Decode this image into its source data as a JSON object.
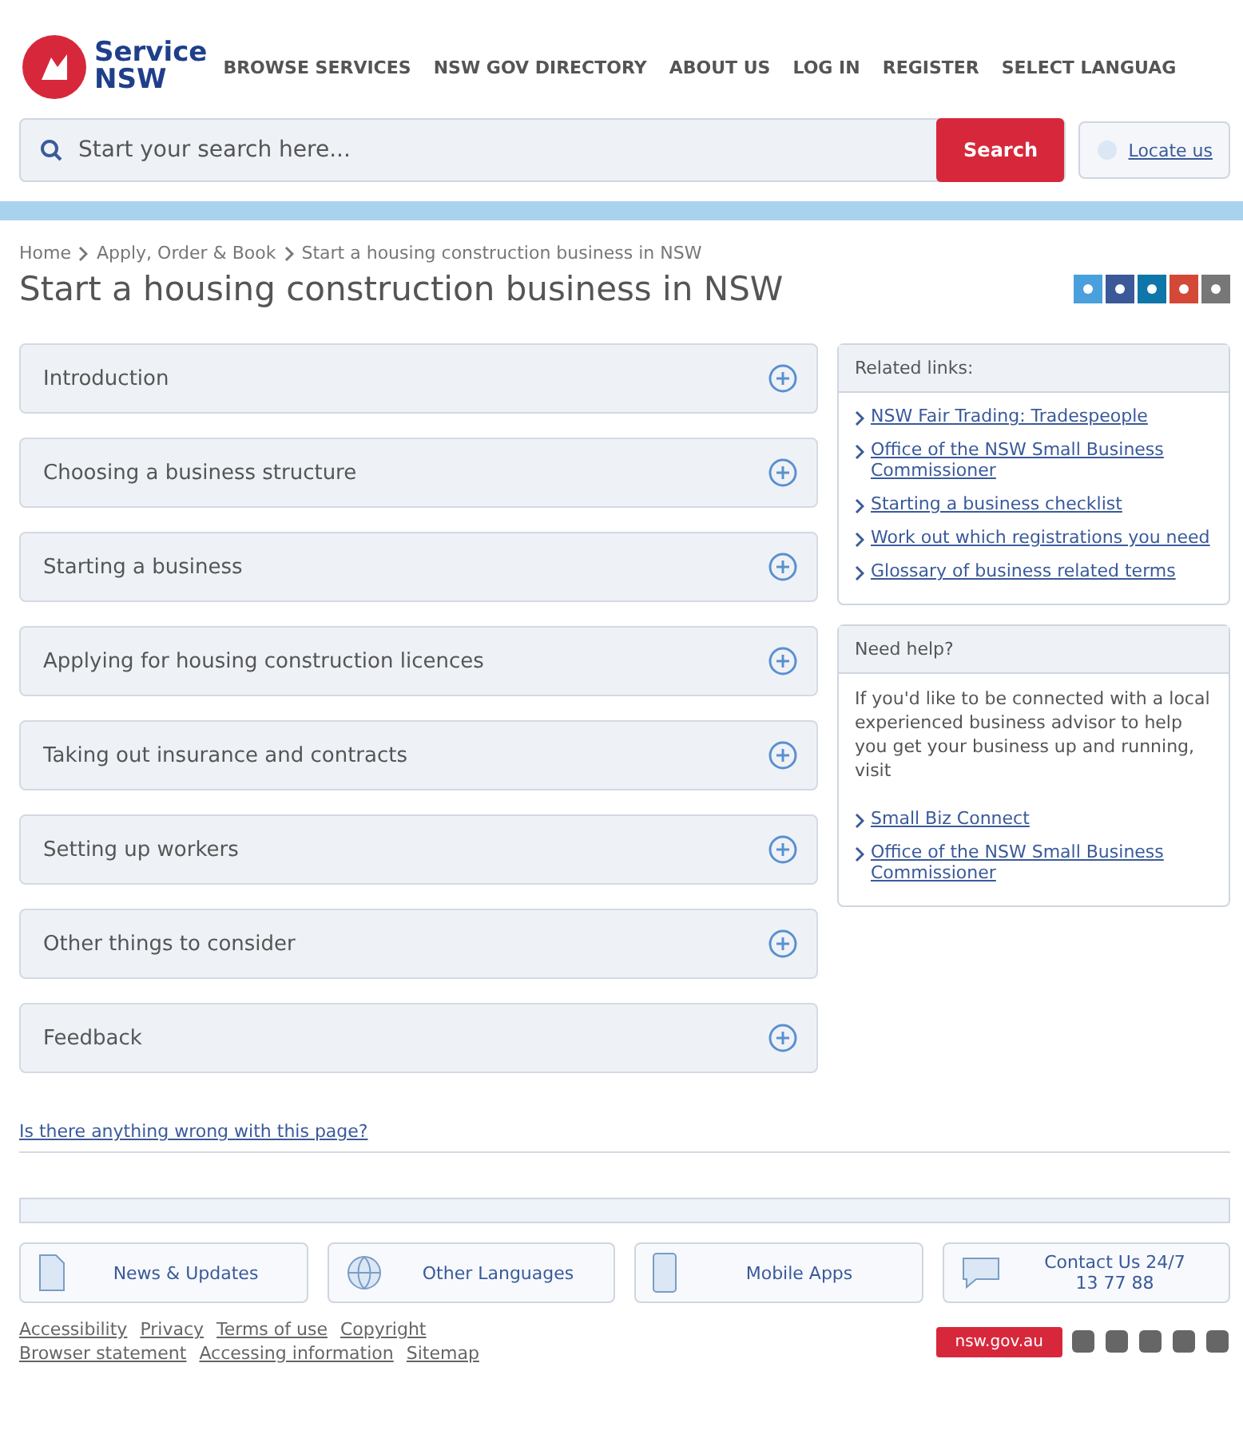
{
  "header": {
    "logo": {
      "line1": "Service",
      "line2": "NSW"
    },
    "nav": [
      "BROWSE SERVICES",
      "NSW GOV DIRECTORY",
      "ABOUT US",
      "LOG IN",
      "REGISTER",
      "SELECT LANGUAG"
    ]
  },
  "search": {
    "placeholder": "Start your search here...",
    "button": "Search",
    "locate": "Locate us"
  },
  "breadcrumb": [
    "Home",
    "Apply, Order & Book",
    "Start a housing construction business in NSW"
  ],
  "title": "Start a housing construction business in NSW",
  "accordion": [
    {
      "label": "Introduction"
    },
    {
      "label": "Choosing a business structure"
    },
    {
      "label": "Starting a business"
    },
    {
      "label": "Applying for housing construction licences"
    },
    {
      "label": "Taking out insurance and contracts"
    },
    {
      "label": "Setting up workers"
    },
    {
      "label": "Other things to consider"
    },
    {
      "label": "Feedback"
    }
  ],
  "related_links": {
    "title": "Related links:",
    "links": [
      "NSW Fair Trading: Tradespeople",
      "Office of the NSW Small Business Commissioner",
      "Starting a business checklist",
      "Work out which registrations you need",
      "Glossary of business related terms"
    ]
  },
  "need_help": {
    "title": "Need help?",
    "text": "If you'd like to be connected with a local experienced business advisor to help you get your business up and running, visit",
    "links": [
      "Small Biz Connect",
      "Office of the NSW Small Business Commissioner"
    ]
  },
  "feedback_link": "Is there anything wrong with this page?",
  "footer_tiles": [
    {
      "kind": "news",
      "label": "News & Updates"
    },
    {
      "kind": "languages",
      "label": "Other Languages"
    },
    {
      "kind": "mobile",
      "label": "Mobile Apps"
    },
    {
      "kind": "contact",
      "label": "Contact Us 24/7",
      "sub": "13 77 88"
    }
  ],
  "footer_links": [
    "Accessibility",
    "Privacy",
    "Terms of use",
    "Copyright",
    "Browser statement",
    "Accessing information",
    "Sitemap"
  ],
  "gov_badge": "nsw.gov.au"
}
